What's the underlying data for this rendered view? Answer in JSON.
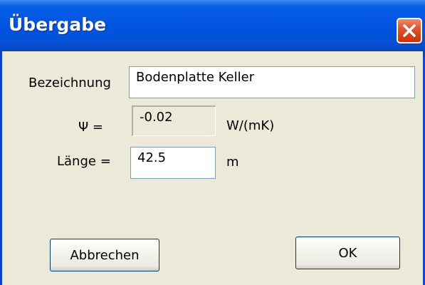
{
  "window": {
    "title": "Übergabe"
  },
  "form": {
    "bezeichnung_label": "Bezeichnung",
    "bezeichnung_value": "Bodenplatte Keller",
    "psi_label": "Ψ =",
    "psi_value": "-0.02",
    "psi_unit": "W/(mK)",
    "laenge_label": "Länge =",
    "laenge_value": "42.5",
    "laenge_unit": "m"
  },
  "buttons": {
    "cancel_label": "Abbrechen",
    "ok_label": "OK"
  },
  "colors": {
    "titlebar": "#0054e3",
    "dialog_bg": "#ece9d8",
    "close_button": "#d4401b"
  }
}
